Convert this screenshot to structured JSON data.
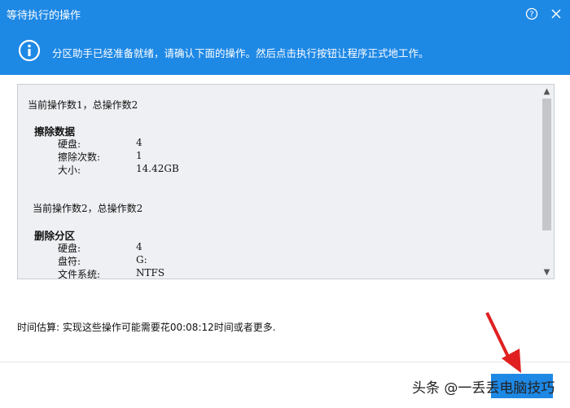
{
  "window": {
    "title": "等待执行的操作",
    "help_icon": "question-icon",
    "close_icon": "close-icon"
  },
  "banner": {
    "icon": "info-icon",
    "message": "分区助手已经准备就绪，请确认下面的操作。然后点击执行按钮让程序正式地工作。"
  },
  "operations": [
    {
      "header": "当前操作数1，总操作数2",
      "name": "擦除数据",
      "details": [
        {
          "label": "硬盘:",
          "value": "4"
        },
        {
          "label": "擦除次数:",
          "value": "1"
        },
        {
          "label": "大小:",
          "value": "14.42GB"
        }
      ]
    },
    {
      "header": "当前操作数2，总操作数2",
      "name": "删除分区",
      "details": [
        {
          "label": "硬盘:",
          "value": "4"
        },
        {
          "label": "盘符:",
          "value": "G:"
        },
        {
          "label": "文件系统:",
          "value": "NTFS"
        }
      ]
    }
  ],
  "estimate": "时间估算: 实现这些操作可能需要花00:08:12时间或者更多.",
  "watermark": "头条 @一丢丢电脑技巧",
  "colors": {
    "accent": "#1e88e5",
    "arrow": "#e02020"
  }
}
